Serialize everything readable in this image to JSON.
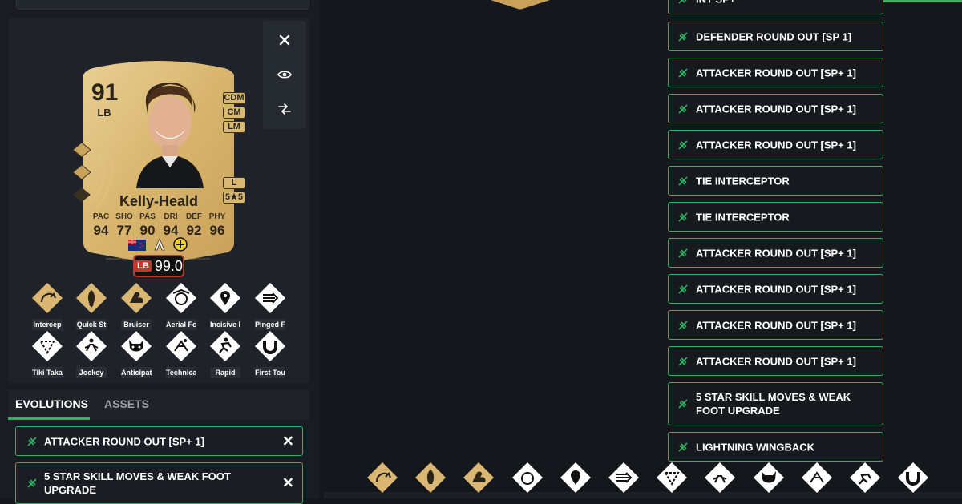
{
  "toolbar": {
    "close_icon": "close-icon",
    "view_icon": "eye-icon",
    "compare_icon": "compare-arrows-icon"
  },
  "card": {
    "rating": "91",
    "position": "LB",
    "alt_positions": [
      "CDM",
      "CM",
      "LM"
    ],
    "foot": "L",
    "skills_weakfoot": "5★5",
    "name": "Kelly-Heald",
    "stats": [
      {
        "label": "PAC",
        "value": "94"
      },
      {
        "label": "SHO",
        "value": "77"
      },
      {
        "label": "PAS",
        "value": "90"
      },
      {
        "label": "DRI",
        "value": "94"
      },
      {
        "label": "DEF",
        "value": "92"
      },
      {
        "label": "PHY",
        "value": "96"
      }
    ],
    "ovr_pos": "LB",
    "ovr_value": "99.0"
  },
  "playstyles_row1": [
    "Intercep",
    "Quick St",
    "Bruiser",
    "Aerial Fo",
    "Incisive F",
    "Pinged F"
  ],
  "playstyles_row2": [
    "Tiki Taka",
    "Jockey",
    "Anticipat",
    "Technica",
    "Rapid",
    "First Tou"
  ],
  "tabs": {
    "evolutions": "EVOLUTIONS",
    "assets": "ASSETS"
  },
  "applied_evolutions": [
    "ATTACKER ROUND OUT [SP+ 1]",
    "5 STAR SKILL MOVES & WEAK FOOT UPGRADE"
  ],
  "evolution_list": [
    "INT SP+",
    "DEFENDER ROUND OUT [SP 1]",
    "ATTACKER ROUND OUT [SP+ 1]",
    "ATTACKER ROUND OUT [SP+ 1]",
    "ATTACKER ROUND OUT [SP+ 1]",
    "TIE INTERCEPTOR",
    "TIE INTERCEPTOR",
    "ATTACKER ROUND OUT [SP+ 1]",
    "ATTACKER ROUND OUT [SP+ 1]",
    "ATTACKER ROUND OUT [SP+ 1]",
    "ATTACKER ROUND OUT [SP+ 1]",
    "5 STAR SKILL MOVES & WEAK FOOT UPGRADE",
    "LIGHTNING WINGBACK"
  ],
  "colors": {
    "accent": "#2fb463",
    "gold": "#d9b772",
    "ovr_red": "#c0392b"
  }
}
